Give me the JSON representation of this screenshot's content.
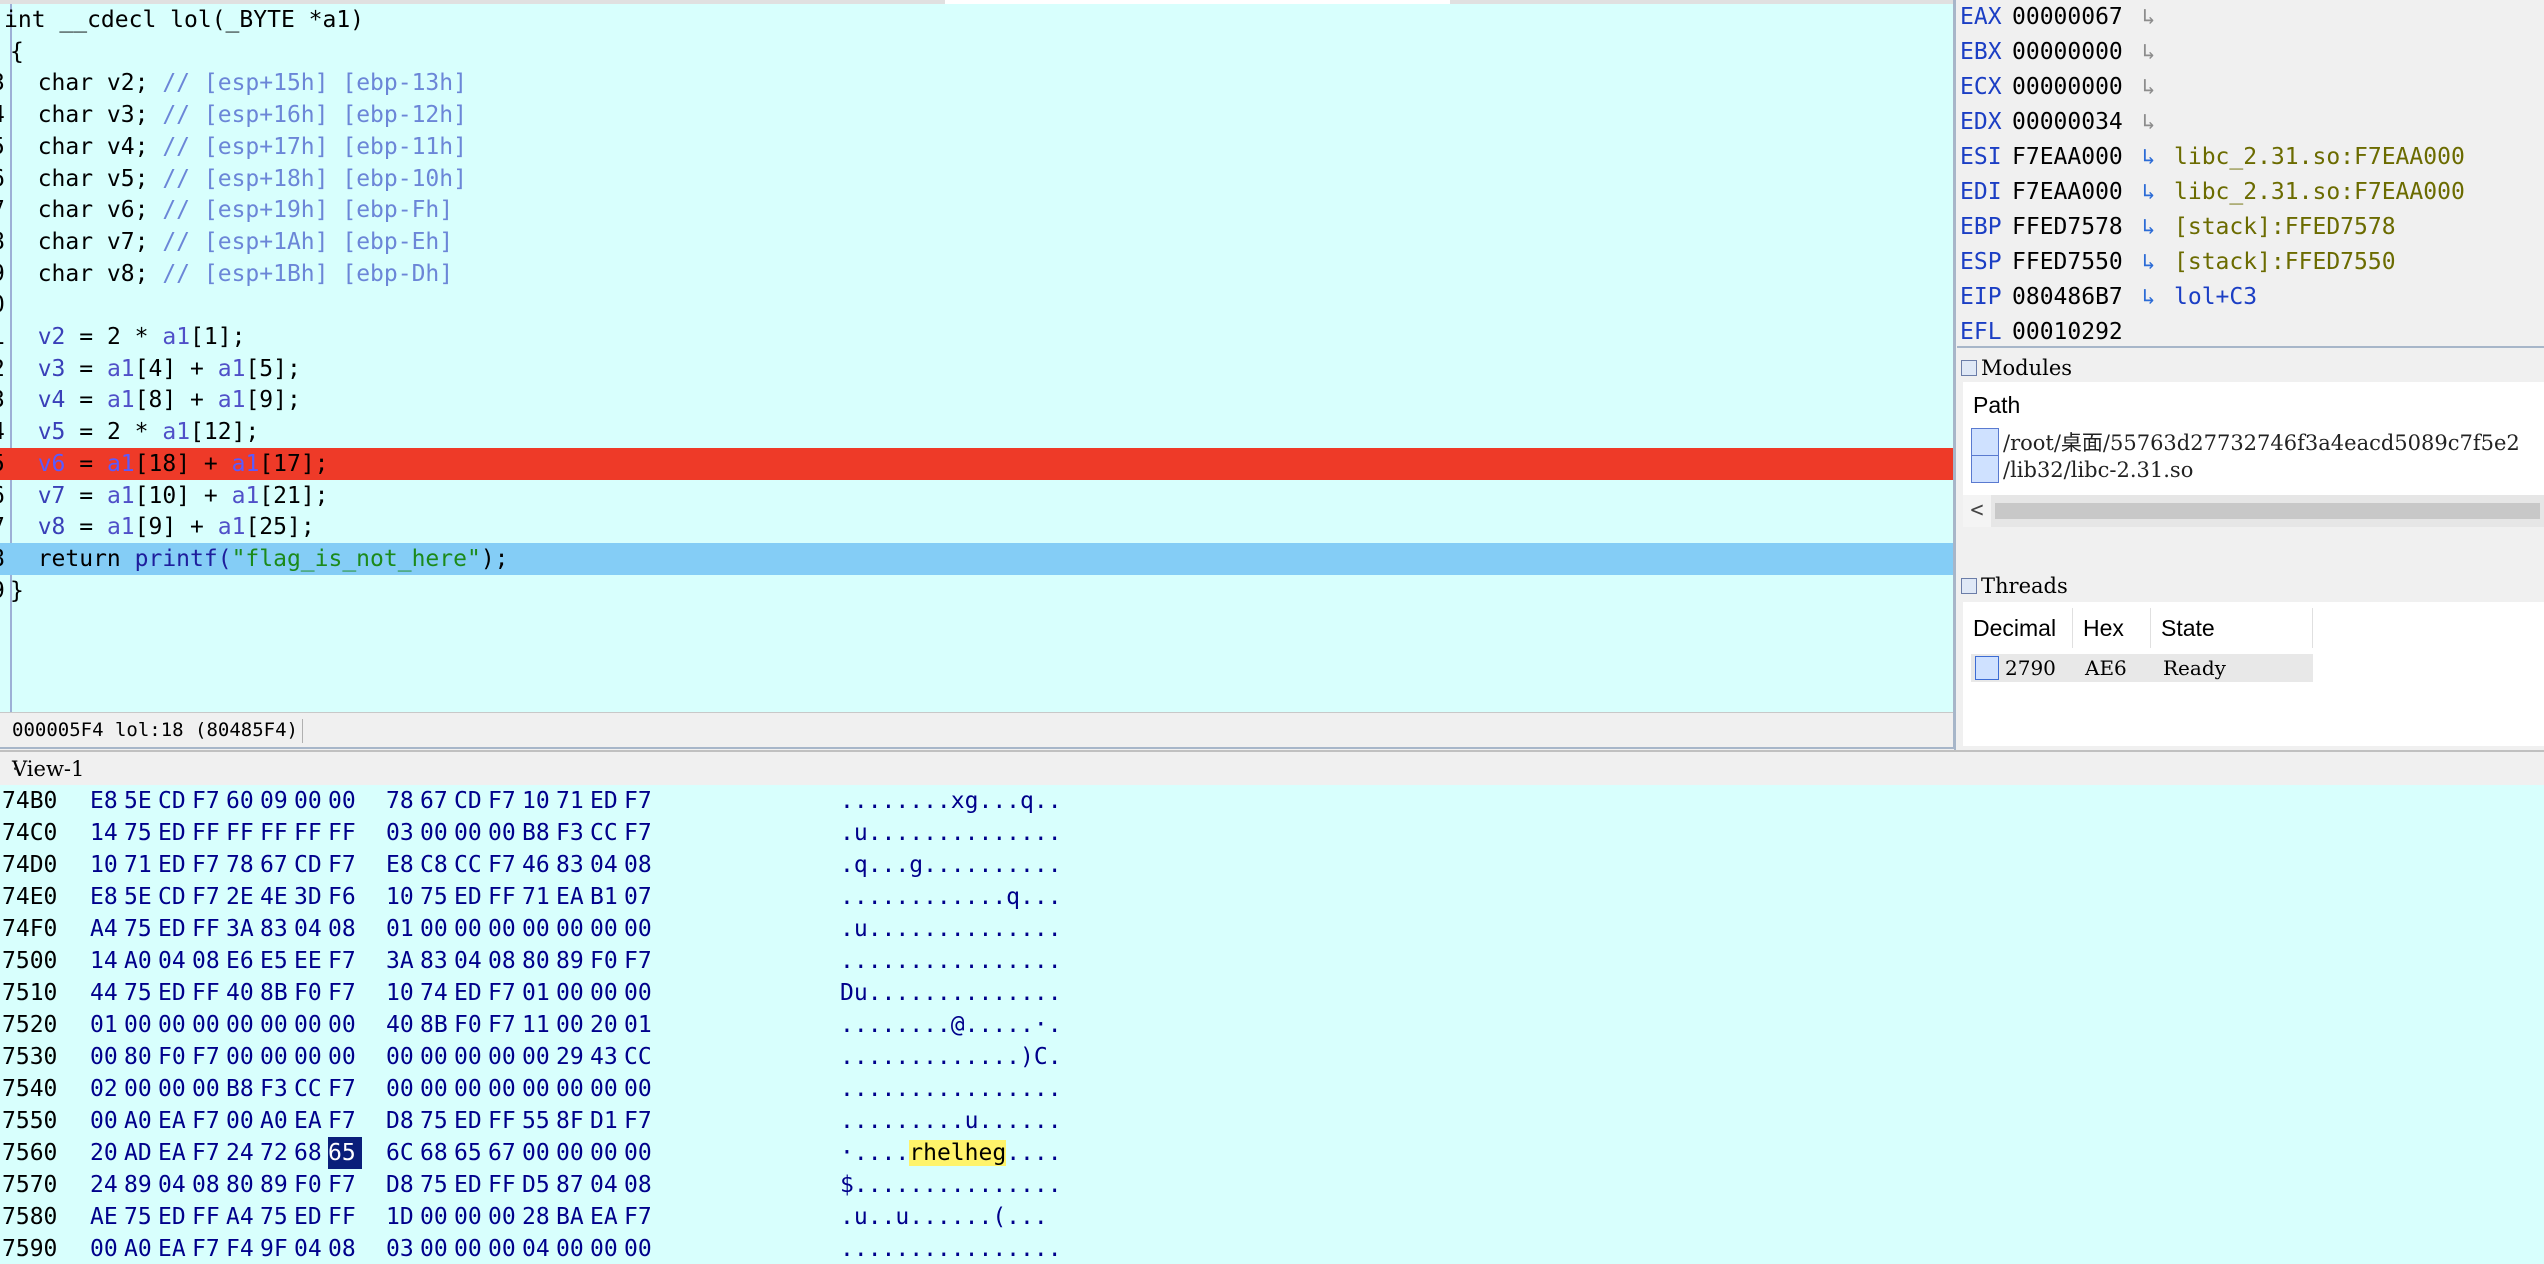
{
  "pseudocode": {
    "signature": "int __cdecl lol(_BYTE *a1)",
    "lines": [
      {
        "ln": "",
        "text": "int __cdecl lol(_BYTE *a1)"
      },
      {
        "ln": "",
        "text": "{"
      },
      {
        "ln": "3",
        "decl": "char v2;",
        "comment": "// [esp+15h] [ebp-13h]"
      },
      {
        "ln": "4",
        "decl": "char v3;",
        "comment": "// [esp+16h] [ebp-12h]"
      },
      {
        "ln": "5",
        "decl": "char v4;",
        "comment": "// [esp+17h] [ebp-11h]"
      },
      {
        "ln": "6",
        "decl": "char v5;",
        "comment": "// [esp+18h] [ebp-10h]"
      },
      {
        "ln": "7",
        "decl": "char v6;",
        "comment": "// [esp+19h] [ebp-Fh]"
      },
      {
        "ln": "8",
        "decl": "char v7;",
        "comment": "// [esp+1Ah] [ebp-Eh]"
      },
      {
        "ln": "9",
        "decl": "char v8;",
        "comment": "// [esp+1Bh] [ebp-Dh]"
      },
      {
        "ln": "0",
        "text": ""
      },
      {
        "ln": "1",
        "stmt": "v2 = 2 * a1[1];"
      },
      {
        "ln": "2",
        "stmt": "v3 = a1[4] + a1[5];"
      },
      {
        "ln": "3",
        "stmt": "v4 = a1[8] + a1[9];"
      },
      {
        "ln": "4",
        "stmt": "v5 = 2 * a1[12];"
      },
      {
        "ln": "5",
        "stmt": "v6 = a1[18] + a1[17];",
        "highlight": "red"
      },
      {
        "ln": "6",
        "stmt": "v7 = a1[10] + a1[21];"
      },
      {
        "ln": "7",
        "stmt": "v8 = a1[9] + a1[25];"
      },
      {
        "ln": "8",
        "ret_kw": "return",
        "ret_fn": "printf(",
        "ret_str": "\"flag_is_not_here\"",
        "ret_end": ");",
        "highlight": "blue"
      },
      {
        "ln": "9",
        "text": "}"
      }
    ],
    "status_left": "000005F4 lol:18 (80485F4)"
  },
  "registers": [
    {
      "name": "EAX",
      "value": "00000067",
      "ref": "",
      "arrow": "gray"
    },
    {
      "name": "EBX",
      "value": "00000000",
      "ref": "",
      "arrow": "gray"
    },
    {
      "name": "ECX",
      "value": "00000000",
      "ref": "",
      "arrow": "gray"
    },
    {
      "name": "EDX",
      "value": "00000034",
      "ref": "",
      "arrow": "gray"
    },
    {
      "name": "ESI",
      "value": "F7EAA000",
      "ref": "libc_2.31.so:F7EAA000",
      "arrow": "blue"
    },
    {
      "name": "EDI",
      "value": "F7EAA000",
      "ref": "libc_2.31.so:F7EAA000",
      "arrow": "blue"
    },
    {
      "name": "EBP",
      "value": "FFED7578",
      "ref": "[stack]:FFED7578",
      "arrow": "blue"
    },
    {
      "name": "ESP",
      "value": "FFED7550",
      "ref": "[stack]:FFED7550",
      "arrow": "blue"
    },
    {
      "name": "EIP",
      "value": "080486B7",
      "ref": "lol+C3",
      "arrow": "blue",
      "ref_type": "code"
    },
    {
      "name": "EFL",
      "value": "00010292",
      "ref": "",
      "arrow": ""
    }
  ],
  "modules": {
    "title": "Modules",
    "column": "Path",
    "items": [
      "/root/桌面/55763d27732746f3a4eacd5089c7f5e2",
      "/lib32/libc-2.31.so"
    ],
    "scroll_left": "<"
  },
  "threads": {
    "title": "Threads",
    "columns": [
      "Decimal",
      "Hex",
      "State"
    ],
    "rows": [
      {
        "decimal": "2790",
        "hex": "AE6",
        "state": "Ready"
      }
    ]
  },
  "hexview": {
    "title": "View-1",
    "rows": [
      {
        "addr": "74B0",
        "bytes": [
          "E8",
          "5E",
          "CD",
          "F7",
          "60",
          "09",
          "00",
          "00",
          "78",
          "67",
          "CD",
          "F7",
          "10",
          "71",
          "ED",
          "F7"
        ],
        "ascii": "........xg...q.."
      },
      {
        "addr": "74C0",
        "bytes": [
          "14",
          "75",
          "ED",
          "FF",
          "FF",
          "FF",
          "FF",
          "FF",
          "03",
          "00",
          "00",
          "00",
          "B8",
          "F3",
          "CC",
          "F7"
        ],
        "ascii": ".u.............."
      },
      {
        "addr": "74D0",
        "bytes": [
          "10",
          "71",
          "ED",
          "F7",
          "78",
          "67",
          "CD",
          "F7",
          "E8",
          "C8",
          "CC",
          "F7",
          "46",
          "83",
          "04",
          "08"
        ],
        "ascii": ".q...g.........."
      },
      {
        "addr": "74E0",
        "bytes": [
          "E8",
          "5E",
          "CD",
          "F7",
          "2E",
          "4E",
          "3D",
          "F6",
          "10",
          "75",
          "ED",
          "FF",
          "71",
          "EA",
          "B1",
          "07"
        ],
        "ascii": "............q..."
      },
      {
        "addr": "74F0",
        "bytes": [
          "A4",
          "75",
          "ED",
          "FF",
          "3A",
          "83",
          "04",
          "08",
          "01",
          "00",
          "00",
          "00",
          "00",
          "00",
          "00",
          "00"
        ],
        "ascii": ".u.............."
      },
      {
        "addr": "7500",
        "bytes": [
          "14",
          "A0",
          "04",
          "08",
          "E6",
          "E5",
          "EE",
          "F7",
          "3A",
          "83",
          "04",
          "08",
          "80",
          "89",
          "F0",
          "F7"
        ],
        "ascii": "................"
      },
      {
        "addr": "7510",
        "bytes": [
          "44",
          "75",
          "ED",
          "FF",
          "40",
          "8B",
          "F0",
          "F7",
          "10",
          "74",
          "ED",
          "F7",
          "01",
          "00",
          "00",
          "00"
        ],
        "ascii": "Du.............."
      },
      {
        "addr": "7520",
        "bytes": [
          "01",
          "00",
          "00",
          "00",
          "00",
          "00",
          "00",
          "00",
          "40",
          "8B",
          "F0",
          "F7",
          "11",
          "00",
          "20",
          "01"
        ],
        "ascii": "........@.....·."
      },
      {
        "addr": "7530",
        "bytes": [
          "00",
          "80",
          "F0",
          "F7",
          "00",
          "00",
          "00",
          "00",
          "00",
          "00",
          "00",
          "00",
          "00",
          "29",
          "43",
          "CC"
        ],
        "ascii": ".............)C."
      },
      {
        "addr": "7540",
        "bytes": [
          "02",
          "00",
          "00",
          "00",
          "B8",
          "F3",
          "CC",
          "F7",
          "00",
          "00",
          "00",
          "00",
          "00",
          "00",
          "00",
          "00"
        ],
        "ascii": "................"
      },
      {
        "addr": "7550",
        "bytes": [
          "00",
          "A0",
          "EA",
          "F7",
          "00",
          "A0",
          "EA",
          "F7",
          "D8",
          "75",
          "ED",
          "FF",
          "55",
          "8F",
          "D1",
          "F7"
        ],
        "ascii": ".........u......"
      },
      {
        "addr": "7560",
        "bytes": [
          "20",
          "AD",
          "EA",
          "F7",
          "24",
          "72",
          "68",
          "65",
          "6C",
          "68",
          "65",
          "67",
          "00",
          "00",
          "00",
          "00"
        ],
        "ascii_pre": "·....",
        "ascii_hl": "rhelheg",
        "ascii_post": "....",
        "sel": 7
      },
      {
        "addr": "7570",
        "bytes": [
          "24",
          "89",
          "04",
          "08",
          "80",
          "89",
          "F0",
          "F7",
          "D8",
          "75",
          "ED",
          "FF",
          "D5",
          "87",
          "04",
          "08"
        ],
        "ascii": "$..............."
      },
      {
        "addr": "7580",
        "bytes": [
          "AE",
          "75",
          "ED",
          "FF",
          "A4",
          "75",
          "ED",
          "FF",
          "1D",
          "00",
          "00",
          "00",
          "28",
          "BA",
          "EA",
          "F7"
        ],
        "ascii": ".u..u......(..."
      },
      {
        "addr": "7590",
        "bytes": [
          "00",
          "A0",
          "EA",
          "F7",
          "F4",
          "9F",
          "04",
          "08",
          "03",
          "00",
          "00",
          "00",
          "04",
          "00",
          "00",
          "00"
        ],
        "ascii": "................"
      }
    ]
  }
}
